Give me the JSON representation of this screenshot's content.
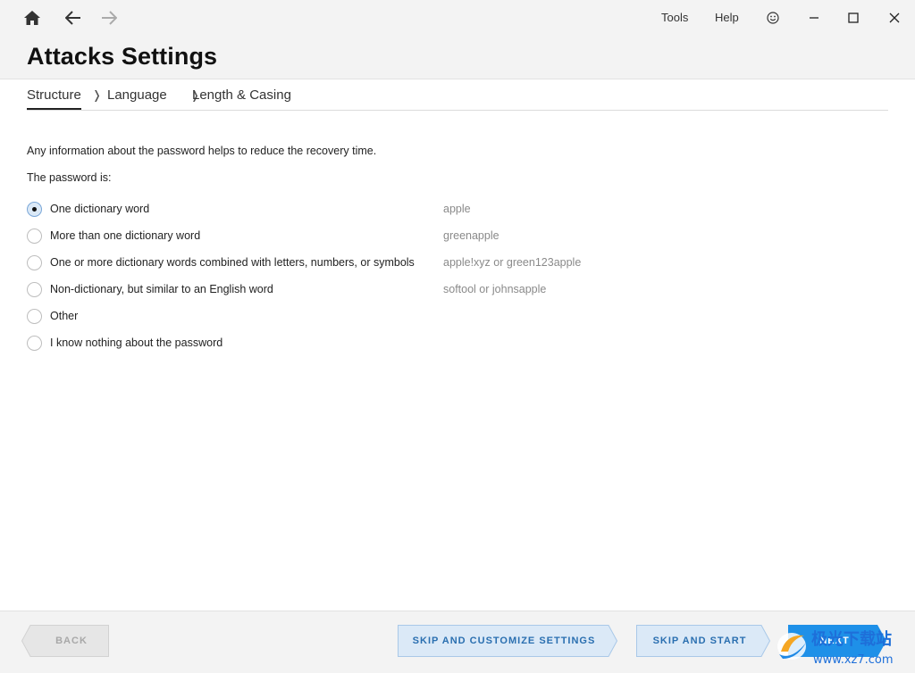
{
  "topbar": {
    "tools": "Tools",
    "help": "Help"
  },
  "page": {
    "title": "Attacks Settings"
  },
  "breadcrumb": {
    "items": [
      {
        "label": "Structure"
      },
      {
        "label": "Language"
      },
      {
        "label": "Length & Casing"
      }
    ],
    "separator": "❭"
  },
  "main": {
    "intro": "Any information about the password helps to reduce the recovery time.",
    "question": "The password is:",
    "options": [
      {
        "label": "One dictionary word",
        "example": "apple",
        "checked": true
      },
      {
        "label": "More than one dictionary word",
        "example": "greenapple",
        "checked": false
      },
      {
        "label": "One or more dictionary words combined with letters, numbers, or symbols",
        "example": "apple!xyz or green123apple",
        "checked": false
      },
      {
        "label": "Non-dictionary, but similar to an English word",
        "example": "softool or johnsapple",
        "checked": false
      },
      {
        "label": "Other",
        "example": "",
        "checked": false
      },
      {
        "label": "I know nothing about the password",
        "example": "",
        "checked": false
      }
    ]
  },
  "footer": {
    "back": "BACK",
    "skip_customize": "SKIP AND CUSTOMIZE SETTINGS",
    "skip_start": "SKIP AND START",
    "next": "NEXT"
  },
  "watermark": {
    "text": "极光下载站",
    "url": "www.xz7.com"
  },
  "colors": {
    "accent": "#1e90e8",
    "button_light": "#dbe9f7",
    "button_text": "#2a6fb0",
    "disabled": "#e6e6e6"
  }
}
